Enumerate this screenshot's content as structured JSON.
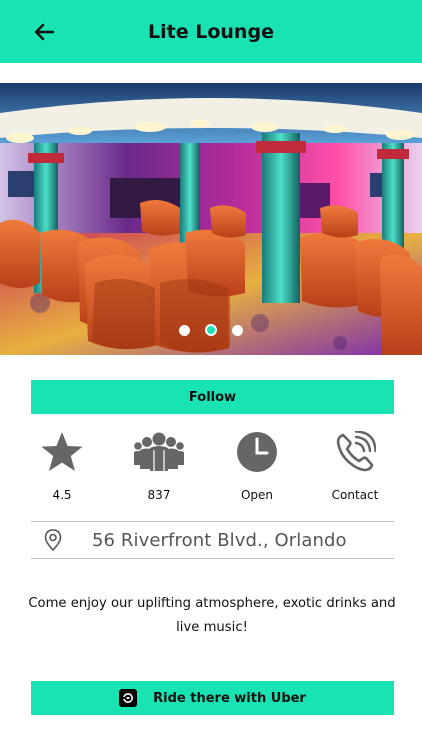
{
  "header": {
    "title": "Lite Lounge",
    "background_color": "#19e2b3"
  },
  "carousel": {
    "slide_count": 3,
    "active_index": 1,
    "active_dot_color": "#19e2b3"
  },
  "follow_button": {
    "label": "Follow"
  },
  "stats": [
    {
      "icon": "star-icon",
      "label": "4.5"
    },
    {
      "icon": "group-icon",
      "label": "837"
    },
    {
      "icon": "clock-icon",
      "label": "Open"
    },
    {
      "icon": "phone-icon",
      "label": "Contact"
    }
  ],
  "address": {
    "icon": "location-pin-icon",
    "text": "56 Riverfront Blvd., Orlando"
  },
  "description": "Come enjoy our uplifting atmosphere, exotic drinks and live music!",
  "uber_button": {
    "icon": "uber-icon",
    "label": "Ride there with Uber"
  },
  "colors": {
    "accent": "#19e2b3",
    "icon_gray": "#666666"
  }
}
